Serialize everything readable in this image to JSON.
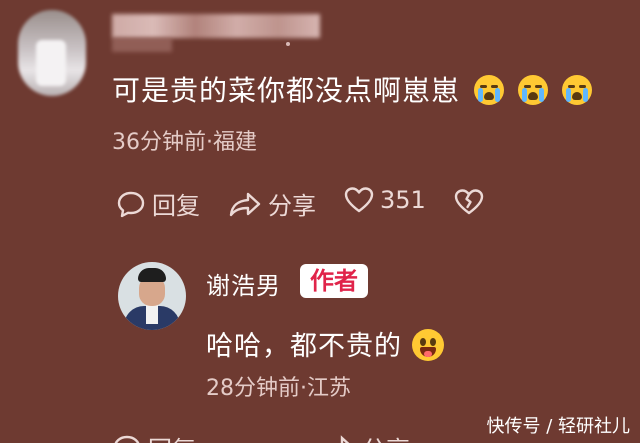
{
  "comment": {
    "username_blurred": true,
    "text": "可是贵的菜你都没点啊崽崽",
    "emojis": [
      "crying-face-emoji",
      "crying-face-emoji",
      "crying-face-emoji"
    ],
    "time_location": "36分钟前·福建",
    "actions": {
      "reply_label": "回复",
      "share_label": "分享",
      "like_count": "351"
    }
  },
  "reply": {
    "username": "谢浩男",
    "badge": "作者",
    "text": "哈哈，都不贵的",
    "emoji": "grinning-face-emoji",
    "time_location": "28分钟前·江苏",
    "actions": {
      "reply_label": "回复",
      "share_label": "分享"
    }
  },
  "watermark": "快传号 / 轻研社儿",
  "colors": {
    "background": "#6e3a31",
    "badge_text": "#e0244a",
    "text": "#ffffff",
    "meta": "#e4cbc7"
  }
}
